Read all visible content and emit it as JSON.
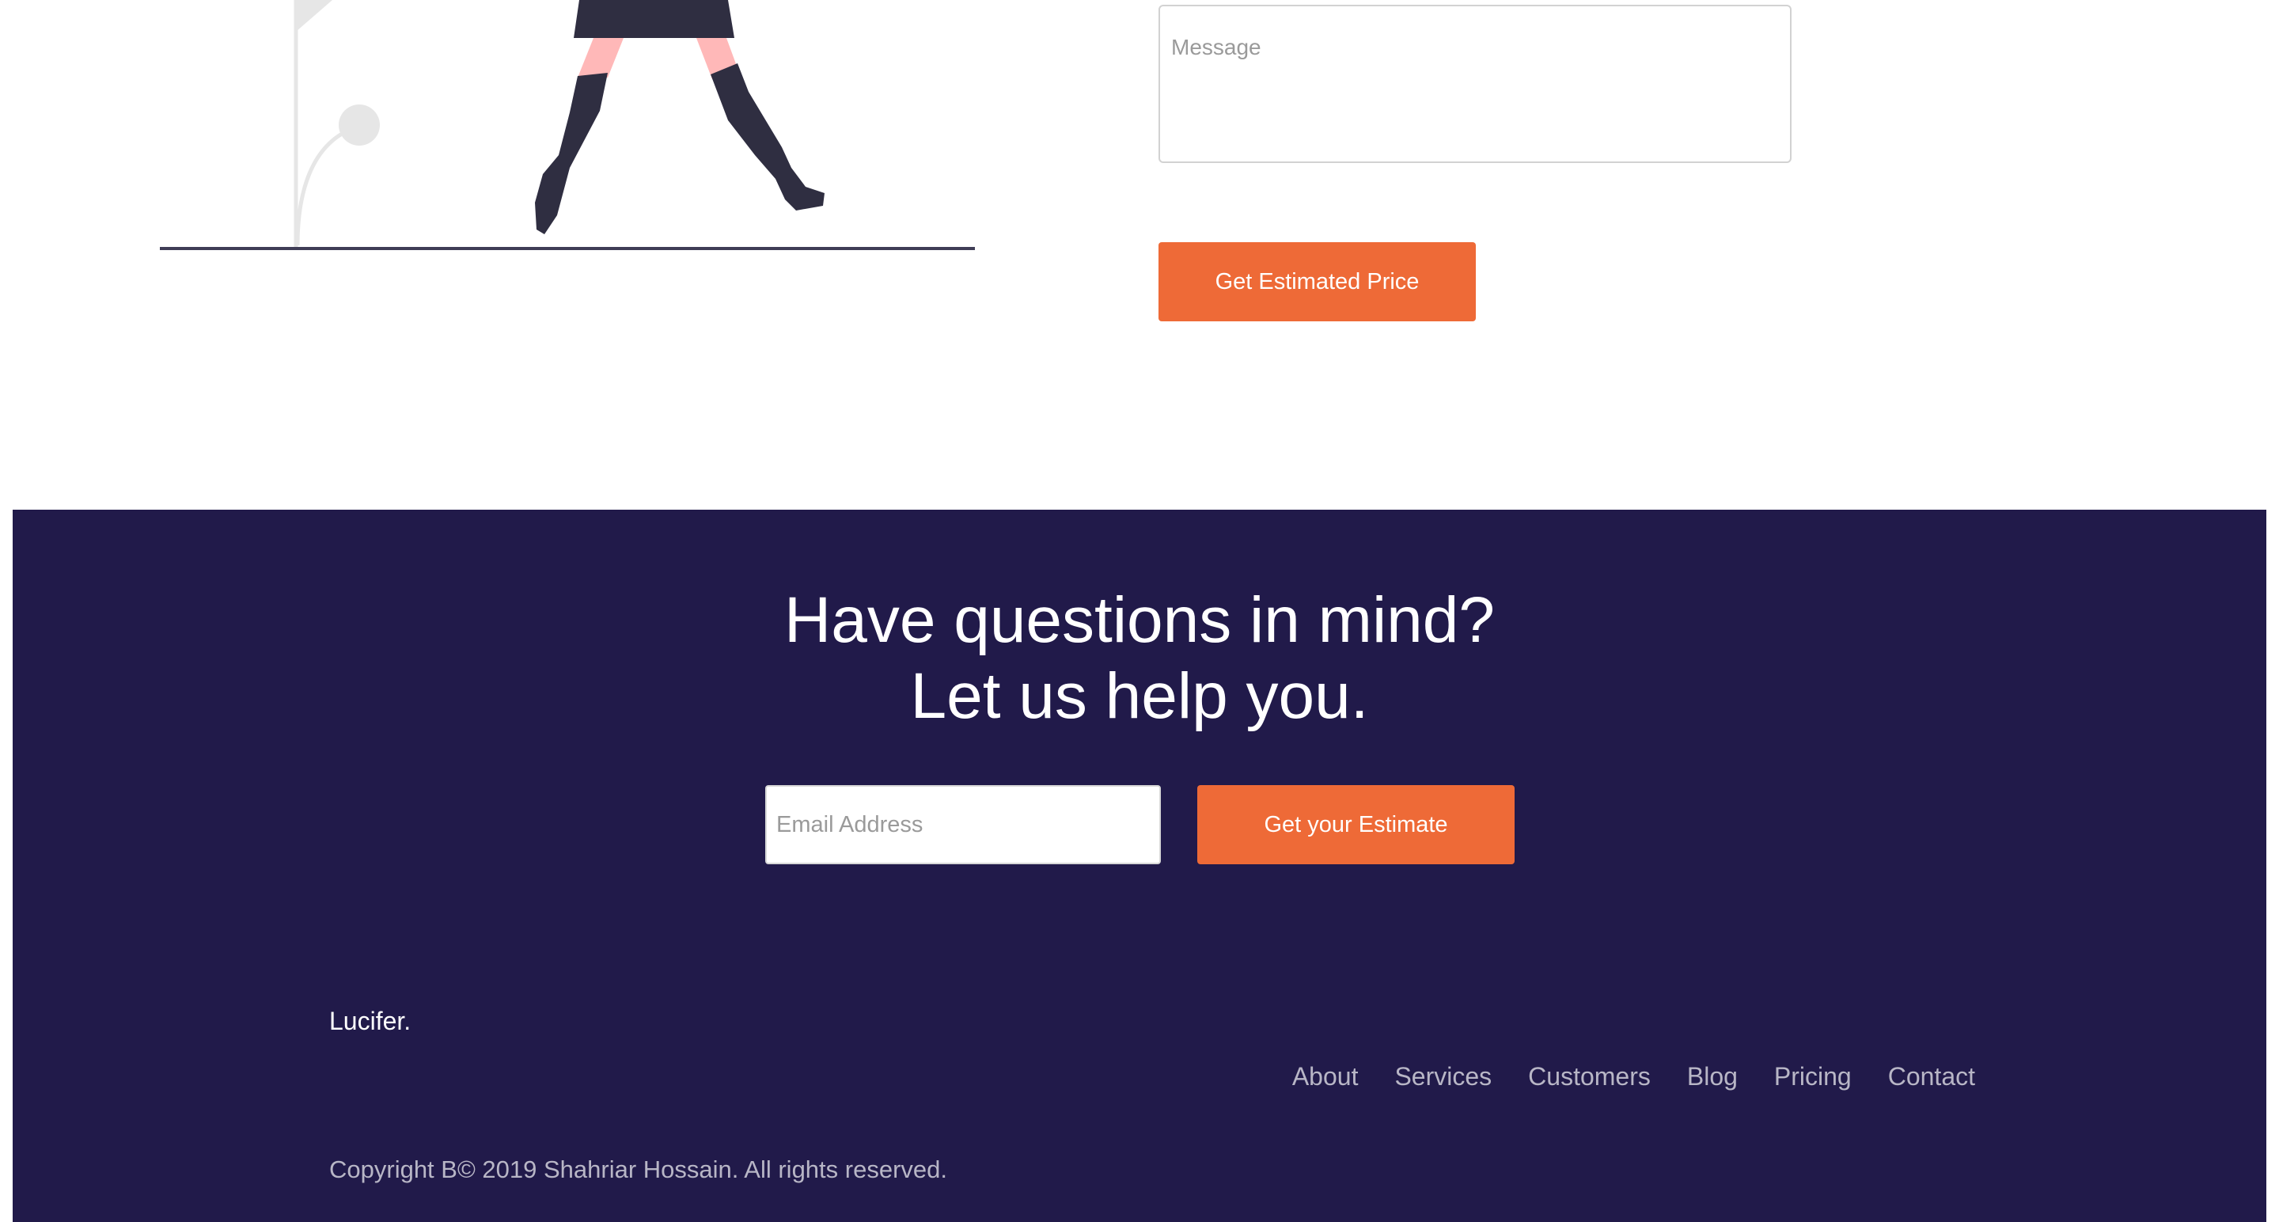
{
  "form": {
    "message_placeholder": "Message",
    "submit_label": "Get Estimated Price"
  },
  "footer": {
    "heading_line1": "Have questions in mind?",
    "heading_line2": "Let us help you.",
    "email_placeholder": "Email Address",
    "cta_label": "Get your Estimate",
    "brand": "Lucifer.",
    "nav": [
      {
        "label": "About"
      },
      {
        "label": "Services"
      },
      {
        "label": "Customers"
      },
      {
        "label": "Blog"
      },
      {
        "label": "Pricing"
      },
      {
        "label": "Contact"
      }
    ],
    "copyright": "Copyright B© 2019 Shahriar Hossain. All rights reserved."
  },
  "colors": {
    "accent": "#ee6a37",
    "footer_bg": "#211a4a",
    "illustration_dark": "#2f2e41",
    "illustration_skin": "#ffb8b8",
    "illustration_light": "#e6e6e6"
  },
  "icons": {
    "illustration": "woman-walking-illustration"
  }
}
